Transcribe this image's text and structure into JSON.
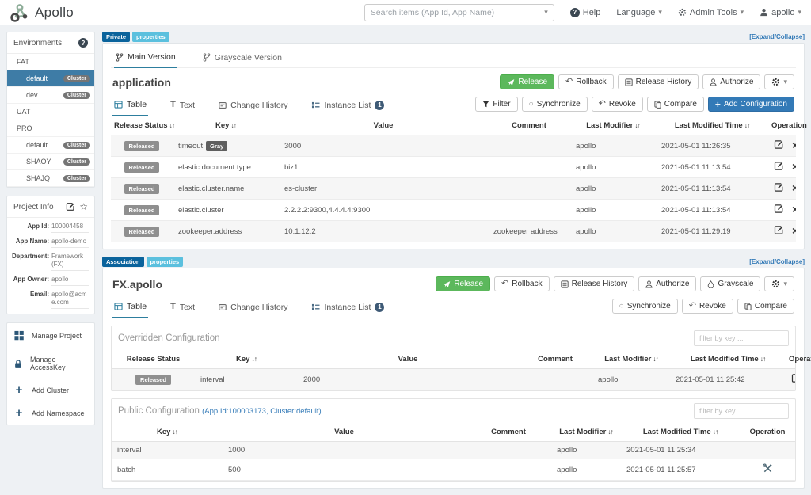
{
  "navbar": {
    "brand": "Apollo",
    "search_placeholder": "Search items (App Id, App Name)",
    "help": "Help",
    "language": "Language",
    "admin_tools": "Admin Tools",
    "user": "apollo"
  },
  "sidebar": {
    "environments": {
      "title": "Environments",
      "cluster_badge": "Cluster",
      "items": [
        {
          "label": "FAT",
          "type": "env",
          "active": false
        },
        {
          "label": "default",
          "type": "cluster",
          "active": true
        },
        {
          "label": "dev",
          "type": "cluster",
          "active": false
        },
        {
          "label": "UAT",
          "type": "env",
          "active": false
        },
        {
          "label": "PRO",
          "type": "env",
          "active": false
        },
        {
          "label": "default",
          "type": "cluster",
          "active": false
        },
        {
          "label": "SHAOY",
          "type": "cluster",
          "active": false
        },
        {
          "label": "SHAJQ",
          "type": "cluster",
          "active": false
        }
      ]
    },
    "project_info": {
      "title": "Project Info",
      "fields": [
        {
          "label": "App Id:",
          "value": "100004458"
        },
        {
          "label": "App Name:",
          "value": "apollo-demo"
        },
        {
          "label": "Department:",
          "value": "Framework (FX)"
        },
        {
          "label": "App Owner:",
          "value": "apollo"
        },
        {
          "label": "Email:",
          "value": "apollo@acme.com"
        }
      ]
    },
    "actions": [
      {
        "icon": "grid-icon",
        "label": "Manage Project"
      },
      {
        "icon": "lock-icon",
        "label": "Manage AccessKey"
      },
      {
        "icon": "plus-icon",
        "label": "Add Cluster"
      },
      {
        "icon": "plus-icon",
        "label": "Add Namespace"
      }
    ]
  },
  "app": {
    "badges": {
      "type": "Private",
      "format": "properties"
    },
    "expand": "[Expand/Collapse]",
    "tabs": {
      "main": "Main Version",
      "gray": "Grayscale Version"
    },
    "title": "application",
    "actions": {
      "release": "Release",
      "rollback": "Rollback",
      "history": "Release History",
      "authorize": "Authorize"
    },
    "views": {
      "table": "Table",
      "text": "Text",
      "history": "Change History",
      "instances": "Instance List",
      "instance_count": "1"
    },
    "tools": {
      "filter": "Filter",
      "sync": "Synchronize",
      "revoke": "Revoke",
      "compare": "Compare",
      "add": "Add Configuration"
    },
    "table": {
      "released_label": "Released",
      "headers": [
        {
          "label": "Release Status",
          "sortable": true
        },
        {
          "label": "Key",
          "sortable": true
        },
        {
          "label": "Value",
          "sortable": false
        },
        {
          "label": "Comment",
          "sortable": false
        },
        {
          "label": "Last Modifier",
          "sortable": true
        },
        {
          "label": "Last Modified Time",
          "sortable": true
        },
        {
          "label": "Operation",
          "sortable": false
        }
      ],
      "rows": [
        {
          "status": "Released",
          "key": "timeout",
          "key_badge": "Gray",
          "value": "3000",
          "comment": "",
          "modifier": "apollo",
          "time": "2021-05-01 11:26:35"
        },
        {
          "status": "Released",
          "key": "elastic.document.type",
          "key_badge": "",
          "value": "biz1",
          "comment": "",
          "modifier": "apollo",
          "time": "2021-05-01 11:13:54"
        },
        {
          "status": "Released",
          "key": "elastic.cluster.name",
          "key_badge": "",
          "value": "es-cluster",
          "comment": "",
          "modifier": "apollo",
          "time": "2021-05-01 11:13:54"
        },
        {
          "status": "Released",
          "key": "elastic.cluster",
          "key_badge": "",
          "value": "2.2.2.2:9300,4.4.4.4:9300",
          "comment": "",
          "modifier": "apollo",
          "time": "2021-05-01 11:13:54"
        },
        {
          "status": "Released",
          "key": "zookeeper.address",
          "key_badge": "",
          "value": "10.1.12.2",
          "comment": "zookeeper address",
          "modifier": "apollo",
          "time": "2021-05-01 11:29:19"
        }
      ]
    }
  },
  "fx": {
    "badges": {
      "type": "Association",
      "format": "properties"
    },
    "expand": "[Expand/Collapse]",
    "title": "FX.apollo",
    "actions": {
      "release": "Release",
      "rollback": "Rollback",
      "history": "Release History",
      "authorize": "Authorize",
      "grayscale": "Grayscale"
    },
    "views": {
      "table": "Table",
      "text": "Text",
      "history": "Change History",
      "instances": "Instance List",
      "instance_count": "1"
    },
    "tools": {
      "sync": "Synchronize",
      "revoke": "Revoke",
      "compare": "Compare"
    },
    "overridden": {
      "title": "Overridden Configuration",
      "filter_placeholder": "filter by key ...",
      "released_label": "Released",
      "headers": [
        {
          "label": "Release Status",
          "sortable": false
        },
        {
          "label": "Key",
          "sortable": true
        },
        {
          "label": "Value",
          "sortable": false
        },
        {
          "label": "Comment",
          "sortable": false
        },
        {
          "label": "Last Modifier",
          "sortable": true
        },
        {
          "label": "Last Modified Time",
          "sortable": true
        },
        {
          "label": "Operation",
          "sortable": false
        }
      ],
      "rows": [
        {
          "status": "Released",
          "key": "interval",
          "value": "2000",
          "comment": "",
          "modifier": "apollo",
          "time": "2021-05-01 11:25:42"
        }
      ]
    },
    "public": {
      "title": "Public Configuration",
      "subtitle": "(App Id:100003173, Cluster:default)",
      "filter_placeholder": "filter by key ...",
      "headers": [
        {
          "label": "Key",
          "sortable": true
        },
        {
          "label": "Value",
          "sortable": false
        },
        {
          "label": "Comment",
          "sortable": false
        },
        {
          "label": "Last Modifier",
          "sortable": true
        },
        {
          "label": "Last Modified Time",
          "sortable": true
        },
        {
          "label": "Operation",
          "sortable": false
        }
      ],
      "rows": [
        {
          "key": "interval",
          "value": "1000",
          "comment": "",
          "modifier": "apollo",
          "time": "2021-05-01 11:25:34",
          "op": "none"
        },
        {
          "key": "batch",
          "value": "500",
          "comment": "",
          "modifier": "apollo",
          "time": "2021-05-01 11:25:57",
          "op": "tools"
        }
      ]
    }
  }
}
